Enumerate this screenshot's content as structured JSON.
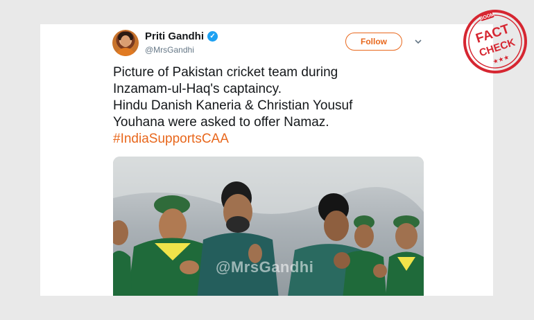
{
  "tweet": {
    "display_name": "Priti Gandhi",
    "handle": "@MrsGandhi",
    "follow_label": "Follow",
    "lines": [
      "Picture of Pakistan cricket team during",
      "Inzamam-ul-Haq's captaincy.",
      "Hindu Danish Kaneria & Christian Yousuf",
      "Youhana were asked to offer Namaz."
    ],
    "hashtag": "#IndiaSupportsCAA",
    "media_watermark": "@MrsGandhi"
  },
  "stamp": {
    "brand": "BOOM",
    "word1": "FACT",
    "word2": "CHECK",
    "stars": "★★★"
  },
  "colors": {
    "accent": "#e8671c",
    "verified": "#1da1f2",
    "stamp_red": "#d62631"
  },
  "icons": {
    "verified": "verified-badge-icon",
    "menu": "chevron-down-icon"
  }
}
